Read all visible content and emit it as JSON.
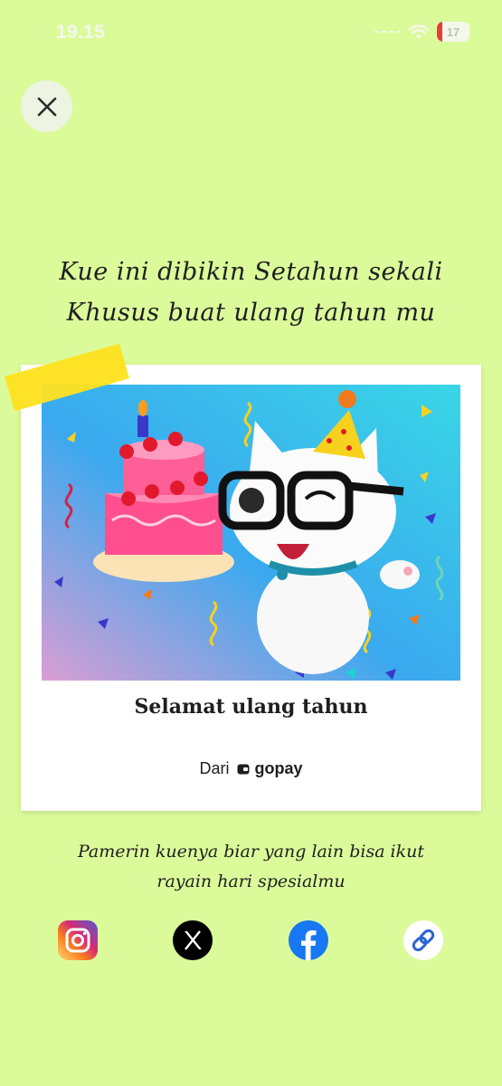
{
  "status_bar": {
    "time": "19.15",
    "battery_level": "17"
  },
  "close": {
    "icon": "close-icon"
  },
  "headline": {
    "line1": "Kue ini dibikin Setahun sekali",
    "line2": "Khusus buat ulang tahun mu"
  },
  "card": {
    "title": "Selamat ulang tahun",
    "name": "",
    "from_label": "Dari",
    "brand": "gopay"
  },
  "caption": {
    "line1": "Pamerin kuenya biar yang lain bisa ikut",
    "line2": "rayain hari spesialmu"
  },
  "share": [
    {
      "name": "Instagram",
      "icon": "instagram-icon",
      "color": "#d6287b"
    },
    {
      "name": "X",
      "icon": "x-icon",
      "color": "#000000"
    },
    {
      "name": "Facebook",
      "icon": "facebook-icon",
      "color": "#1877f2"
    },
    {
      "name": "Copy link",
      "icon": "link-icon",
      "color": "#2a63d6"
    }
  ],
  "colors": {
    "background": "#dbfb9b",
    "tape": "#ffe11e"
  }
}
